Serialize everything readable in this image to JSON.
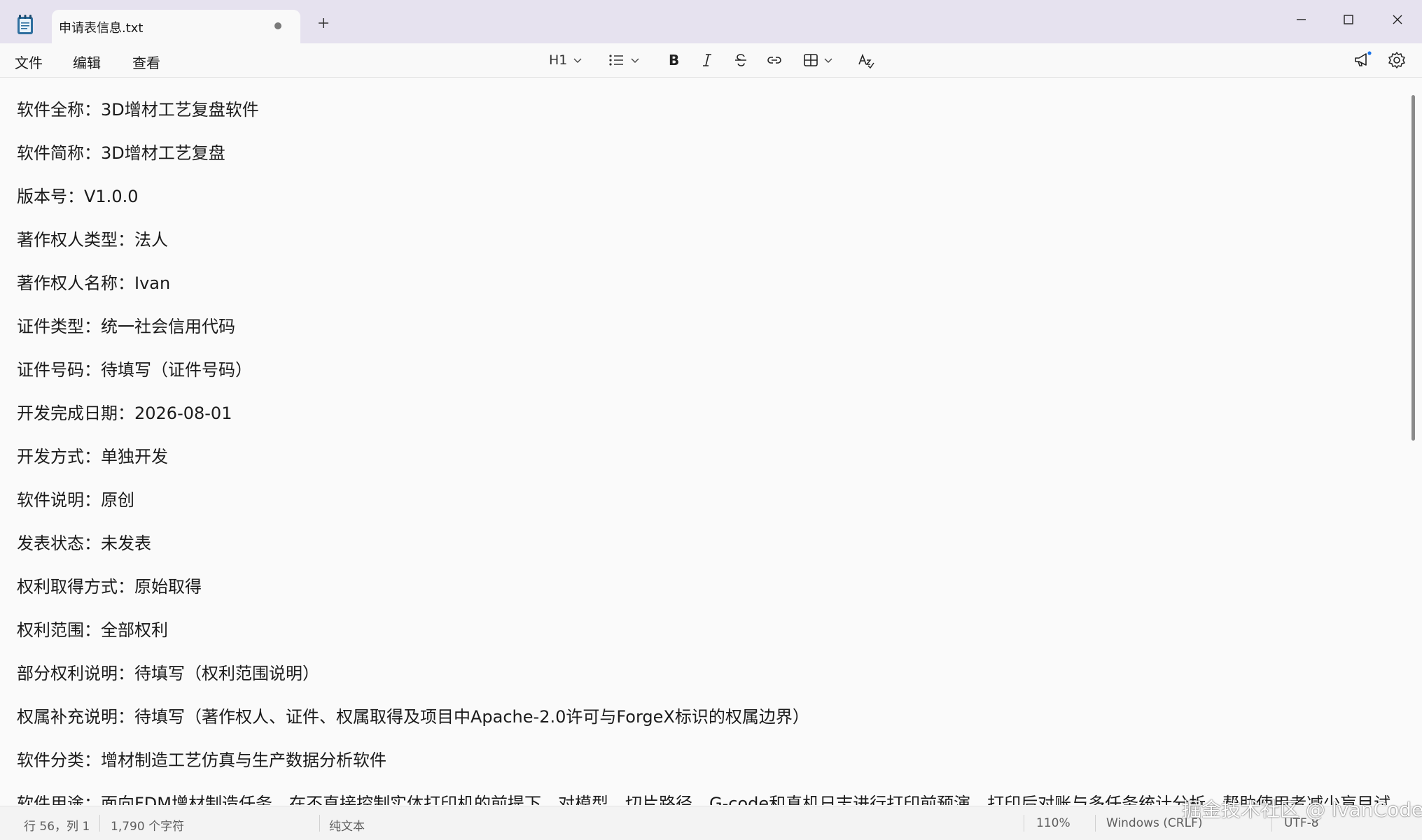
{
  "tab": {
    "title": "申请表信息.txt"
  },
  "menu": {
    "file": "文件",
    "edit": "编辑",
    "view": "查看"
  },
  "toolbar": {
    "heading_label": "H1"
  },
  "document": {
    "lines": [
      "软件全称：3D增材工艺复盘软件",
      "软件简称：3D增材工艺复盘",
      "版本号：V1.0.0",
      "著作权人类型：法人",
      "著作权人名称：Ivan",
      "证件类型：统一社会信用代码",
      "证件号码：待填写（证件号码）",
      "开发完成日期：2026-08-01",
      "开发方式：单独开发",
      "软件说明：原创",
      "发表状态：未发表",
      "权利取得方式：原始取得",
      "权利范围：全部权利",
      "部分权利说明：待填写（权利范围说明）",
      "权属补充说明：待填写（著作权人、证件、权属取得及项目中Apache-2.0许可与ForgeX标识的权属边界）",
      "软件分类：增材制造工艺仿真与生产数据分析软件",
      "软件用途：面向FDM增材制造任务，在不直接控制实体打印机的前提下，对模型、切片路径、G-code和真机日志进行打印前预演、打印后对账与多任务统计分析，帮助使用者减少盲目试"
    ]
  },
  "status": {
    "position": "行 56，列 1",
    "char_count": "1,790 个字符",
    "format": "纯文本",
    "zoom": "110%",
    "line_ending": "Windows (CRLF)",
    "encoding": "UTF-8"
  },
  "watermark": "掘金技术社区 @ IvanCodes",
  "icons": {
    "app": "notepad-icon",
    "bold": "bold-icon",
    "italic": "italic-icon",
    "strike": "strikethrough-icon",
    "link": "link-icon",
    "table": "table-icon",
    "spell": "spellcheck-icon",
    "announce": "megaphone-icon",
    "settings": "gear-icon"
  }
}
